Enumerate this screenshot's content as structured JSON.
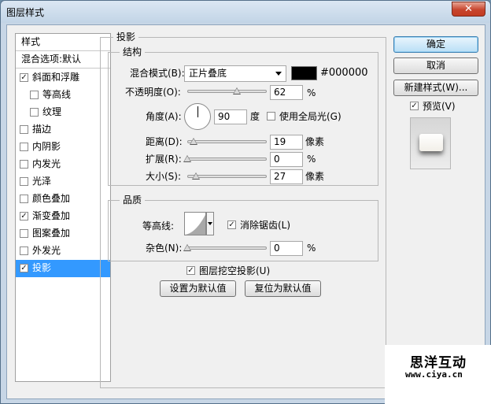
{
  "window": {
    "title": "图层样式",
    "close_glyph": "✕"
  },
  "style_list": {
    "items": [
      {
        "label": "样式",
        "type": "header"
      },
      {
        "label": "混合选项:默认",
        "type": "header"
      },
      {
        "label": "斜面和浮雕",
        "checked": true
      },
      {
        "label": "等高线",
        "checked": false,
        "sub": true
      },
      {
        "label": "纹理",
        "checked": false,
        "sub": true
      },
      {
        "label": "描边",
        "checked": false
      },
      {
        "label": "内阴影",
        "checked": false
      },
      {
        "label": "内发光",
        "checked": false
      },
      {
        "label": "光泽",
        "checked": false
      },
      {
        "label": "颜色叠加",
        "checked": false
      },
      {
        "label": "渐变叠加",
        "checked": true
      },
      {
        "label": "图案叠加",
        "checked": false
      },
      {
        "label": "外发光",
        "checked": false
      },
      {
        "label": "投影",
        "checked": true,
        "selected": true
      }
    ]
  },
  "drop_shadow": {
    "title": "投影",
    "structure": {
      "title": "结构",
      "blend_mode_label": "混合模式(B):",
      "blend_mode_value": "正片叠底",
      "color_hex": "#000000",
      "color_swatch": "#000000",
      "opacity_label": "不透明度(O):",
      "opacity_value": "62",
      "opacity_unit": "%",
      "angle_label": "角度(A):",
      "angle_value": "90",
      "angle_unit": "度",
      "global_light_label": "使用全局光(G)",
      "global_light_checked": false,
      "distance_label": "距离(D):",
      "distance_value": "19",
      "distance_unit": "像素",
      "spread_label": "扩展(R):",
      "spread_value": "0",
      "spread_unit": "%",
      "size_label": "大小(S):",
      "size_value": "27",
      "size_unit": "像素"
    },
    "quality": {
      "title": "品质",
      "contour_label": "等高线:",
      "anti_alias_label": "消除锯齿(L)",
      "anti_alias_checked": true,
      "noise_label": "杂色(N):",
      "noise_value": "0",
      "noise_unit": "%"
    },
    "knockout_label": "图层挖空投影(U)",
    "knockout_checked": true,
    "make_default_label": "设置为默认值",
    "reset_default_label": "复位为默认值"
  },
  "buttons": {
    "ok": "确定",
    "cancel": "取消",
    "new_style": "新建样式(W)...",
    "preview_label": "预览(V)",
    "preview_checked": true
  },
  "watermark": {
    "title": "思洋互动",
    "url": "www.ciya.cn"
  },
  "check_glyph": "✓"
}
